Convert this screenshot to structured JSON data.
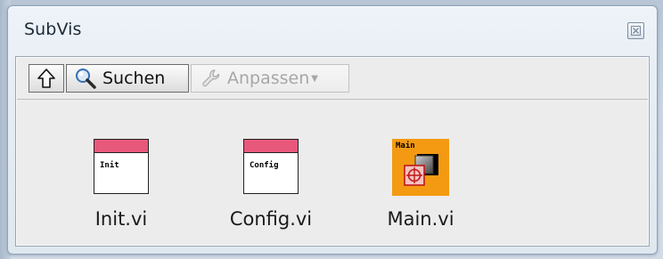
{
  "window": {
    "title": "SubVis"
  },
  "toolbar": {
    "up_icon": "arrow-up-icon",
    "search_label": "Suchen",
    "search_icon": "magnifier-icon",
    "customize_label": "Anpassen",
    "customize_icon": "wrench-icon",
    "customize_enabled": false
  },
  "items": [
    {
      "name": "Init.vi",
      "icon_label": "Init",
      "icon": "vi-init-icon"
    },
    {
      "name": "Config.vi",
      "icon_label": "Config",
      "icon": "vi-config-icon"
    },
    {
      "name": "Main.vi",
      "icon_label": "Main",
      "icon": "vi-main-icon"
    }
  ],
  "colors": {
    "vi_header": "#e8587a",
    "main_icon_bg": "#f39a12",
    "disabled_text": "#a7a7a7"
  }
}
